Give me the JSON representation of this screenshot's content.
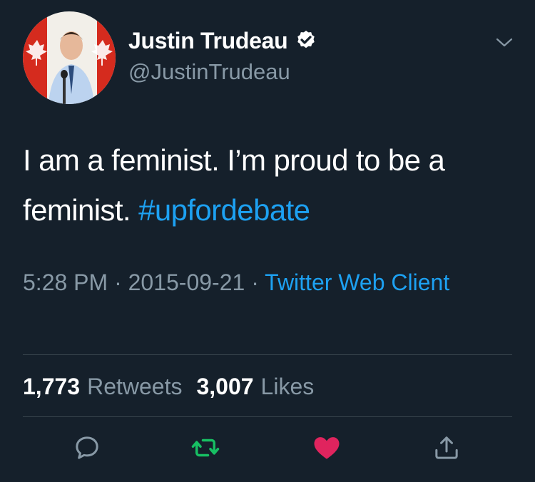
{
  "user": {
    "display_name": "Justin Trudeau",
    "handle": "@JustinTrudeau",
    "verified": true
  },
  "tweet": {
    "text": "I am a feminist. I’m proud to be a feminist.",
    "hashtag": "#upfordebate",
    "time": "5:28 PM",
    "date": "2015-09-21",
    "separator": "·",
    "source": "Twitter Web Client"
  },
  "stats": {
    "retweets_count": "1,773",
    "retweets_label": "Retweets",
    "likes_count": "3,007",
    "likes_label": "Likes"
  },
  "actions": {
    "reply_icon": "reply-icon",
    "retweet_icon": "retweet-icon",
    "like_icon": "heart-icon",
    "share_icon": "share-icon"
  },
  "colors": {
    "background": "#15202b",
    "secondary_text": "#8899a6",
    "link": "#1da1f2",
    "retweet_active": "#17bf63",
    "like_active": "#e0245e",
    "divider": "#38444d"
  }
}
